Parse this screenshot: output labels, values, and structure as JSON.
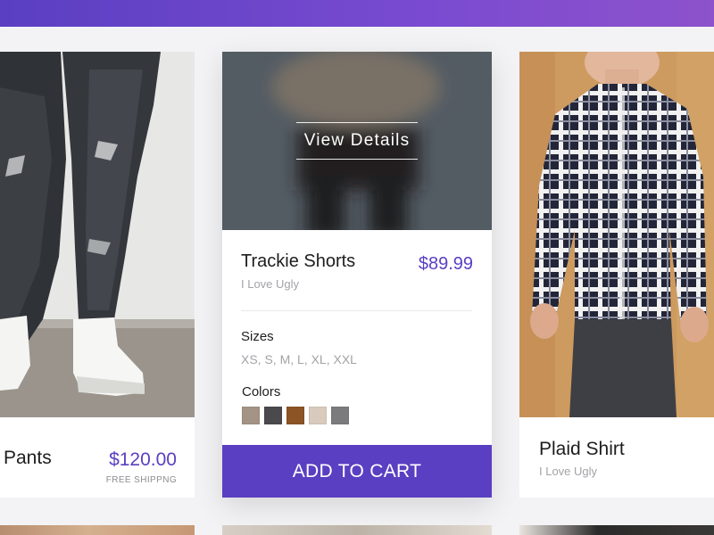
{
  "colors": {
    "accent": "#5a3fc2",
    "topbar_start": "#5a3fc2",
    "topbar_end": "#8d52cc"
  },
  "products": {
    "left": {
      "name": "Pants",
      "price": "$120.00",
      "shipping": "FREE SHIPPNG"
    },
    "center": {
      "overlay_label": "View Details",
      "name": "Trackie Shorts",
      "brand": "I Love Ugly",
      "price": "$89.99",
      "sizes_label": "Sizes",
      "sizes": "XS, S, M, L, XL, XXL",
      "colors_label": "Colors",
      "swatches": [
        "#a39385",
        "#4a4a4c",
        "#8a5424",
        "#d8cabd",
        "#7b7b7e"
      ],
      "cta": "ADD TO CART"
    },
    "right": {
      "name": "Plaid Shirt",
      "brand": "I Love Ugly"
    }
  }
}
